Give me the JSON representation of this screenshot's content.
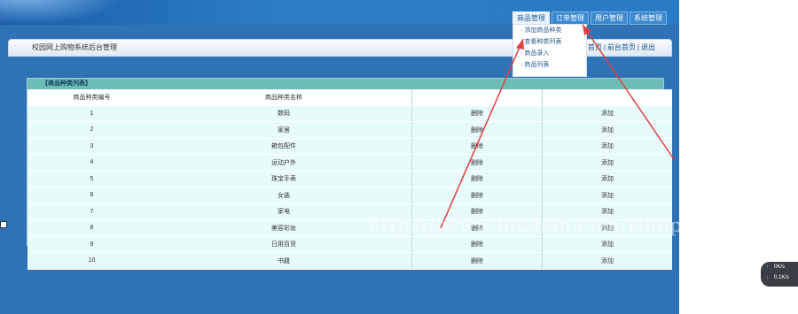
{
  "header": {
    "tabs": [
      {
        "label": "商品管理"
      },
      {
        "label": "订单管理"
      },
      {
        "label": "用户管理"
      },
      {
        "label": "系统管理"
      }
    ]
  },
  "dropdown": {
    "items": [
      {
        "label": "添加商品种类"
      },
      {
        "label": "查看种类列表"
      },
      {
        "label": "商品录入"
      },
      {
        "label": "商品列表"
      }
    ]
  },
  "titlebar": {
    "title": "校园网上购物系统后台管理",
    "link_home": "后台首页",
    "link_front": "前台首页",
    "link_logout": "退出"
  },
  "panel": {
    "heading": "【商品种类列表】",
    "columns": [
      "商品种类编号",
      "商品种类名称",
      "",
      ""
    ],
    "rows": [
      {
        "id": "1",
        "name": "数码",
        "del": "删除",
        "add": "添加"
      },
      {
        "id": "2",
        "name": "家居",
        "del": "删除",
        "add": "添加"
      },
      {
        "id": "3",
        "name": "箱包配件",
        "del": "删除",
        "add": "添加"
      },
      {
        "id": "4",
        "name": "运动户外",
        "del": "删除",
        "add": "添加"
      },
      {
        "id": "5",
        "name": "珠宝手表",
        "del": "删除",
        "add": "添加"
      },
      {
        "id": "6",
        "name": "女装",
        "del": "删除",
        "add": "添加"
      },
      {
        "id": "7",
        "name": "家电",
        "del": "删除",
        "add": "添加"
      },
      {
        "id": "8",
        "name": "美容彩妆",
        "del": "删除",
        "add": "添加"
      },
      {
        "id": "9",
        "name": "日用百货",
        "del": "删除",
        "add": "添加"
      },
      {
        "id": "10",
        "name": "书籍",
        "del": "删除",
        "add": "添加"
      }
    ]
  },
  "watermark": "https://www.huzhan.com/ishop33466",
  "speed": {
    "up": "0K/s",
    "down": "0.1K/s"
  },
  "colors": {
    "page_bg": "#2f72b6",
    "panel_bg": "#e9fbfb",
    "panel_head": "#6dbdb7",
    "arrow": "#e04040"
  }
}
